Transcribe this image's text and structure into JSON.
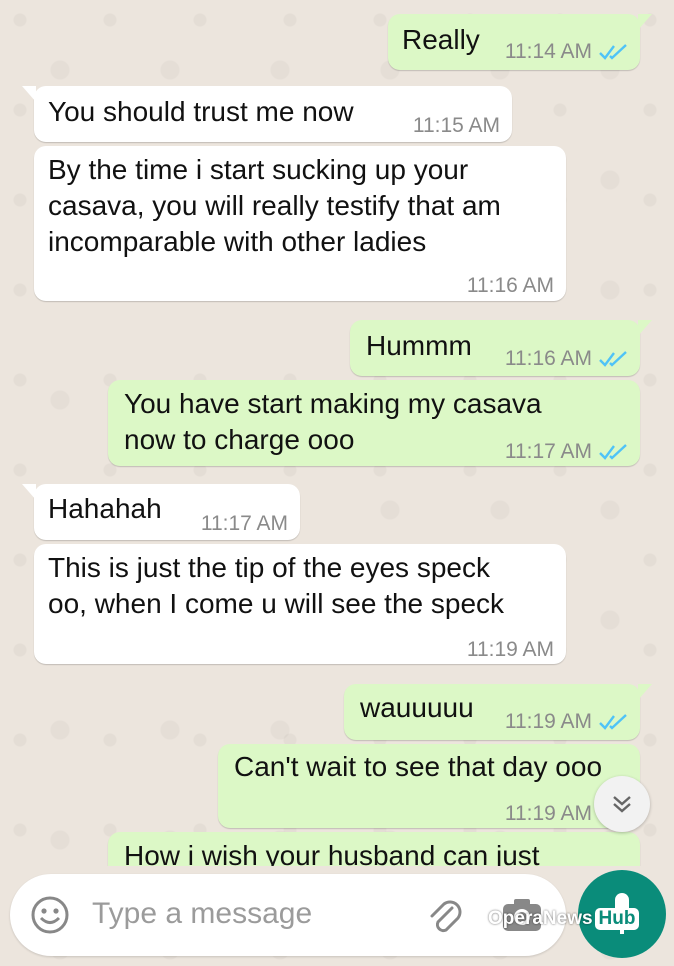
{
  "messages": [
    {
      "dir": "out",
      "text": "Really",
      "time": "11:14 AM"
    },
    {
      "dir": "in",
      "text": "You should trust me now",
      "time": "11:15 AM"
    },
    {
      "dir": "in",
      "text": "By the time i start sucking up your\ncasava, you will really testify that am\nincomparable with other ladies",
      "time": "11:16 AM"
    },
    {
      "dir": "out",
      "text": "Hummm",
      "time": "11:16 AM"
    },
    {
      "dir": "out",
      "text": "You have start making my casava\nnow to charge ooo",
      "time": "11:17 AM"
    },
    {
      "dir": "in",
      "text": "Hahahah",
      "time": "11:17 AM"
    },
    {
      "dir": "in",
      "text": "This is just the tip of the eyes speck\noo, when I come u will see the speck",
      "time": "11:19 AM"
    },
    {
      "dir": "out",
      "text": "wauuuuu",
      "time": "11:19 AM"
    },
    {
      "dir": "out",
      "text": "Can't wait to see that day ooo",
      "time": "11:19 AM"
    },
    {
      "dir": "out",
      "text": "How i wish your husband can just",
      "time": ""
    }
  ],
  "composer": {
    "placeholder": "Type a message",
    "emoji_icon": "emoji-icon",
    "attach_icon": "attach-icon",
    "camera_icon": "camera-icon",
    "mic_icon": "mic-icon"
  },
  "watermark": {
    "text": "OperaNews",
    "badge": "Hub"
  },
  "colors": {
    "incoming_bubble": "#ffffff",
    "outgoing_bubble": "#dcf8c6",
    "read_ticks": "#4fc3f7",
    "mic_button": "#0a8c7a",
    "wallpaper": "#ece5dd"
  }
}
